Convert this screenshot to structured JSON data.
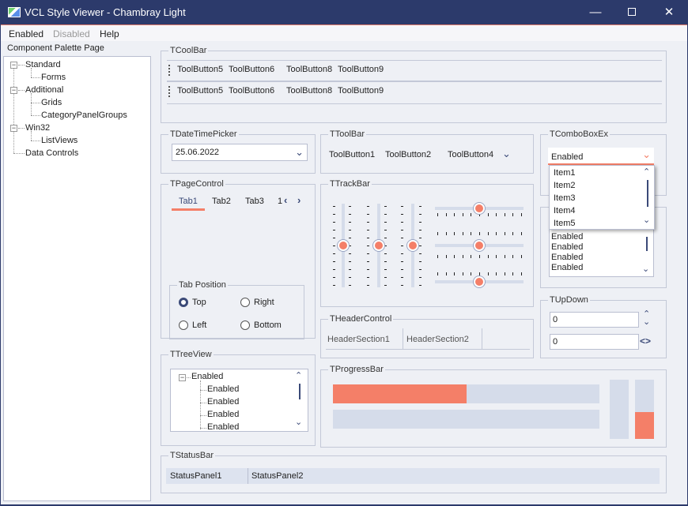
{
  "window": {
    "title": "VCL Style Viewer - Chambray Light",
    "minimize_icon": "minimize-icon",
    "maximize_icon": "maximize-icon",
    "close_icon": "close-icon"
  },
  "menu": {
    "items": [
      "Enabled",
      "Disabled",
      "Help"
    ]
  },
  "tree": {
    "caption": "Component Palette Page",
    "nodes": [
      "Standard",
      "Forms",
      "Additional",
      "Grids",
      "CategoryPanelGroups",
      "Win32",
      "ListViews",
      "Data Controls"
    ]
  },
  "coolbar": {
    "caption": "TCoolBar",
    "row1": [
      "ToolButton5",
      "ToolButton6",
      "ToolButton8",
      "ToolButton9"
    ],
    "row2": [
      "ToolButton5",
      "ToolButton6",
      "ToolButton8",
      "ToolButton9"
    ]
  },
  "datetimepicker": {
    "caption": "TDateTimePicker",
    "value": "25.06.2022"
  },
  "toolbar": {
    "caption": "TToolBar",
    "buttons": [
      "ToolButton1",
      "ToolButton2",
      "ToolButton4"
    ]
  },
  "comboboxex": {
    "caption": "TComboBoxEx",
    "value": "Enabled",
    "items": [
      "Item1",
      "Item2",
      "Item3",
      "Item4",
      "Item5"
    ]
  },
  "listbox": {
    "items": [
      "Enabled",
      "Enabled",
      "Enabled",
      "Enabled"
    ]
  },
  "pagecontrol": {
    "caption": "TPageControl",
    "tabs": [
      "Tab1",
      "Tab2",
      "Tab3",
      "1"
    ],
    "tab_position": {
      "caption": "Tab Position",
      "options": [
        "Top",
        "Right",
        "Left",
        "Bottom"
      ],
      "selected": "Top"
    }
  },
  "trackbar": {
    "caption": "TTrackBar"
  },
  "headercontrol": {
    "caption": "THeaderControl",
    "sections": [
      "HeaderSection1",
      "HeaderSection2"
    ]
  },
  "updown": {
    "caption": "TUpDown",
    "values": [
      "0",
      "0"
    ]
  },
  "treeview": {
    "caption": "TTreeView",
    "root": "Enabled",
    "children": [
      "Enabled",
      "Enabled",
      "Enabled",
      "Enabled"
    ]
  },
  "progressbar": {
    "caption": "TProgressBar",
    "h1": 0.5,
    "h2": 0,
    "v1": 0,
    "v2": 0.45
  },
  "statusbar": {
    "caption": "TStatusBar",
    "panels": [
      "StatusPanel1",
      "StatusPanel2"
    ]
  },
  "colors": {
    "accent": "#f47f68",
    "titlebar": "#2c3a6b",
    "track": "#d5dcea"
  }
}
